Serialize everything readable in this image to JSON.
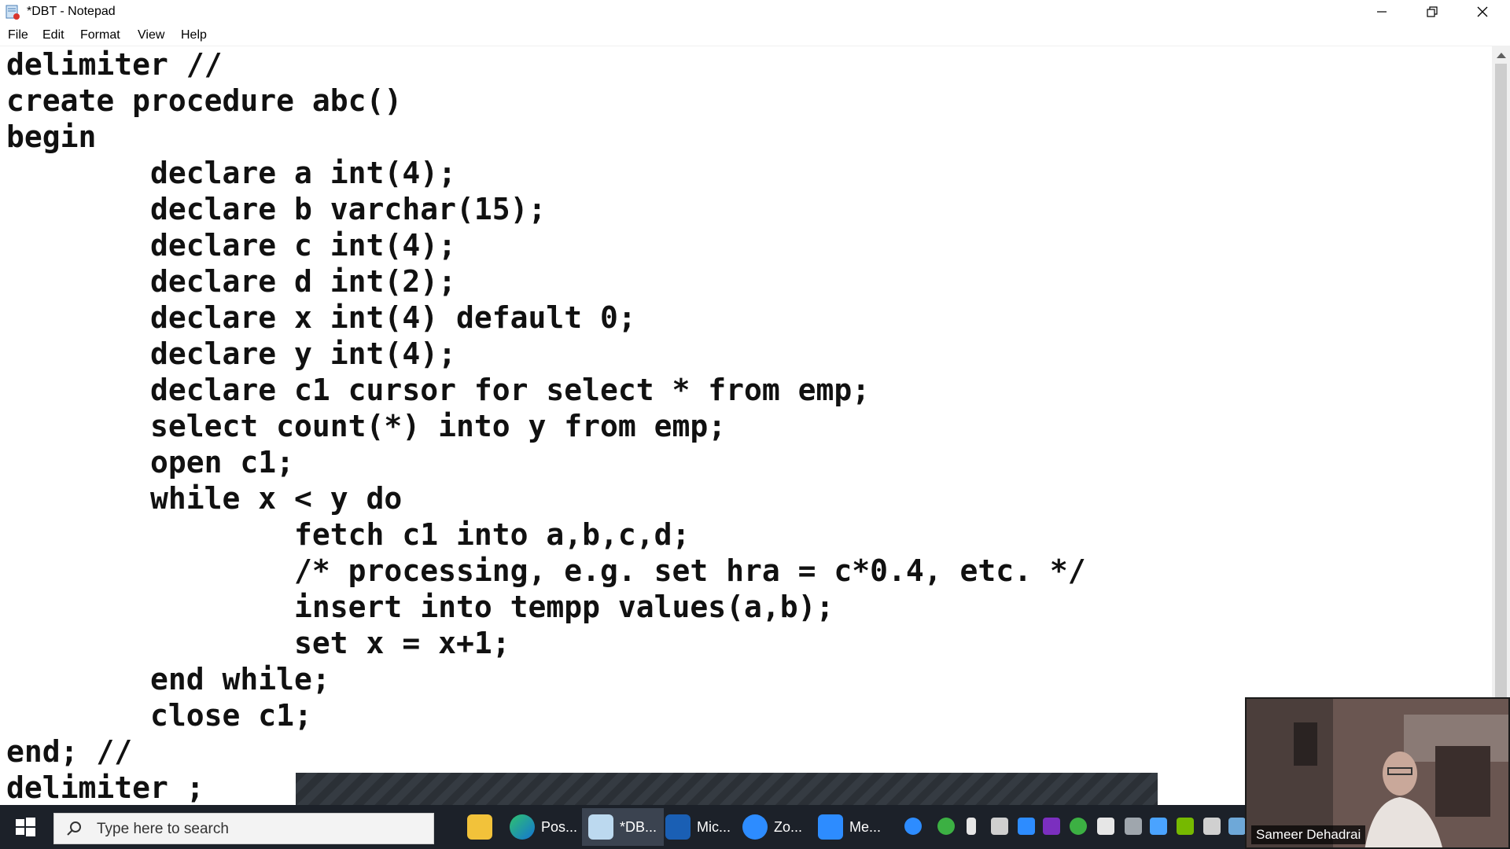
{
  "window": {
    "title": "*DBT - Notepad"
  },
  "menu": [
    "File",
    "Edit",
    "Format",
    "View",
    "Help"
  ],
  "editor": {
    "lines": [
      "delimiter //",
      "create procedure abc()",
      "begin",
      "        declare a int(4);",
      "        declare b varchar(15);",
      "        declare c int(4);",
      "        declare d int(2);",
      "        declare x int(4) default 0;",
      "        declare y int(4);",
      "        declare c1 cursor for select * from emp;",
      "        select count(*) into y from emp;",
      "        open c1;",
      "        while x < y do",
      "                fetch c1 into a,b,c,d;",
      "                /* processing, e.g. set hra = c*0.4, etc. */",
      "                insert into tempp values(a,b);",
      "                set x = x+1;",
      "        end while;",
      "        close c1;",
      "end; //",
      "delimiter ;"
    ]
  },
  "taskbar": {
    "search_placeholder": "Type here to search",
    "apps": [
      {
        "icon": "file-explorer-icon",
        "label": ""
      },
      {
        "icon": "edge-icon",
        "label": "Pos..."
      },
      {
        "icon": "notepad-icon",
        "label": "*DB..."
      },
      {
        "icon": "whiteboard-icon",
        "label": "Mic..."
      },
      {
        "icon": "zoom-icon",
        "label": "Zo..."
      },
      {
        "icon": "zoom-meeting-icon",
        "label": "Me..."
      }
    ]
  },
  "webcam": {
    "name": "Sameer Dehadrai"
  },
  "colors": {
    "taskbar_bg": "#1c2129",
    "editor_text": "#111111",
    "accent_blue": "#0a84ff"
  }
}
